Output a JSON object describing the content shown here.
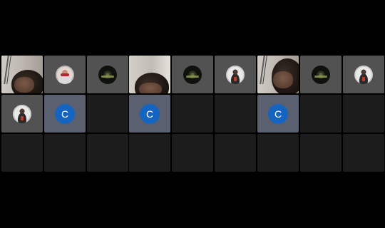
{
  "self_tile": {
    "initial": "C",
    "avatar_color": "#1565c0"
  },
  "panels": [
    {
      "tiles": [
        "camera-video",
        "avatar-photo-a",
        "avatar-photo-b",
        "avatar-photo-c",
        "self",
        "empty",
        "empty",
        "empty",
        "empty"
      ]
    },
    {
      "tiles": [
        "camera-video",
        "avatar-photo-b",
        "avatar-photo-c",
        "self",
        "empty",
        "empty",
        "empty",
        "empty",
        "empty"
      ]
    },
    {
      "tiles": [
        "camera-video",
        "avatar-photo-b",
        "avatar-photo-c",
        "self",
        "empty",
        "empty",
        "empty",
        "empty",
        "empty"
      ]
    }
  ],
  "colors": {
    "background": "#000000",
    "tile_gray": "#525252",
    "tile_empty": "#1c1c1c",
    "tile_self": "#5a6070"
  }
}
